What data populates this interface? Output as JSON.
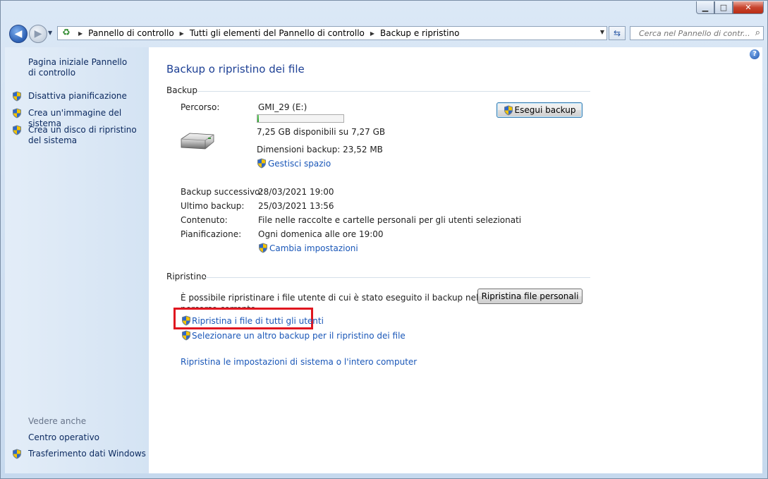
{
  "window": {
    "caption_buttons": {
      "minimize": "▁",
      "maximize": "□",
      "close": "✕"
    }
  },
  "nav": {
    "back_icon": "back-arrow-icon",
    "forward_icon": "forward-arrow-icon",
    "breadcrumbs": [
      "Pannello di controllo",
      "Tutti gli elementi del Pannello di controllo",
      "Backup e ripristino"
    ],
    "search_placeholder": "Cerca nel Pannello di contr..."
  },
  "sidebar": {
    "home_label": "Pagina iniziale Pannello di controllo",
    "items": [
      {
        "label": "Disattiva pianificazione"
      },
      {
        "label": "Crea un'immagine del sistema"
      },
      {
        "label": "Crea un disco di ripristino del sistema"
      }
    ],
    "see_also": "Vedere anche",
    "see_also_items": [
      {
        "label": "Centro operativo"
      },
      {
        "label": "Trasferimento dati Windows"
      }
    ]
  },
  "main": {
    "title": "Backup o ripristino dei file",
    "backup": {
      "header": "Backup",
      "location_label": "Percorso:",
      "drive_name": "GMI_29 (E:)",
      "drive_used_fraction": 0.02,
      "free_space": "7,25 GB disponibili su 7,27 GB",
      "backup_size": "Dimensioni backup: 23,52 MB",
      "manage_space_link": "Gestisci spazio",
      "run_backup_button": "Esegui backup",
      "details": [
        {
          "label": "Backup successivo:",
          "value": "28/03/2021 19:00"
        },
        {
          "label": "Ultimo backup:",
          "value": "25/03/2021 13:56"
        },
        {
          "label": "Contenuto:",
          "value": "File nelle raccolte e cartelle personali per gli utenti selezionati"
        },
        {
          "label": "Pianificazione:",
          "value": "Ogni domenica alle ore 19:00"
        }
      ],
      "change_settings_link": "Cambia impostazioni"
    },
    "restore": {
      "header": "Ripristino",
      "description_line1": "È possibile ripristinare i file utente di cui è stato eseguito il backup nel",
      "description_line2": "percorso corrente.",
      "restore_personal_button": "Ripristina file personali",
      "restore_all_users_link": "Ripristina i file di tutti gli utenti",
      "select_other_backup_link": "Selezionare un altro backup per il ripristino dei file",
      "restore_system_link": "Ripristina le impostazioni di sistema o l'intero computer"
    }
  }
}
